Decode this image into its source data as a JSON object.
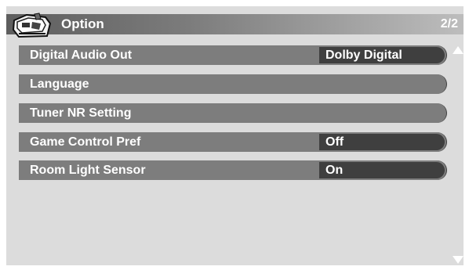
{
  "header": {
    "title": "Option",
    "page": "2/2",
    "icon": "toolbox-icon"
  },
  "rows": [
    {
      "label": "Digital Audio Out",
      "value": "Dolby Digital"
    },
    {
      "label": "Language"
    },
    {
      "label": "Tuner NR Setting"
    },
    {
      "label": "Game Control Pref",
      "value": "Off"
    },
    {
      "label": "Room Light Sensor",
      "value": "On"
    }
  ],
  "scroll": {
    "up_icon": "triangle-up-icon",
    "down_icon": "triangle-down-icon"
  },
  "colors": {
    "panel": "#dcdcdc",
    "row": "#7d7d7d",
    "value_box": "#3f3f3f",
    "text": "#ffffff"
  }
}
